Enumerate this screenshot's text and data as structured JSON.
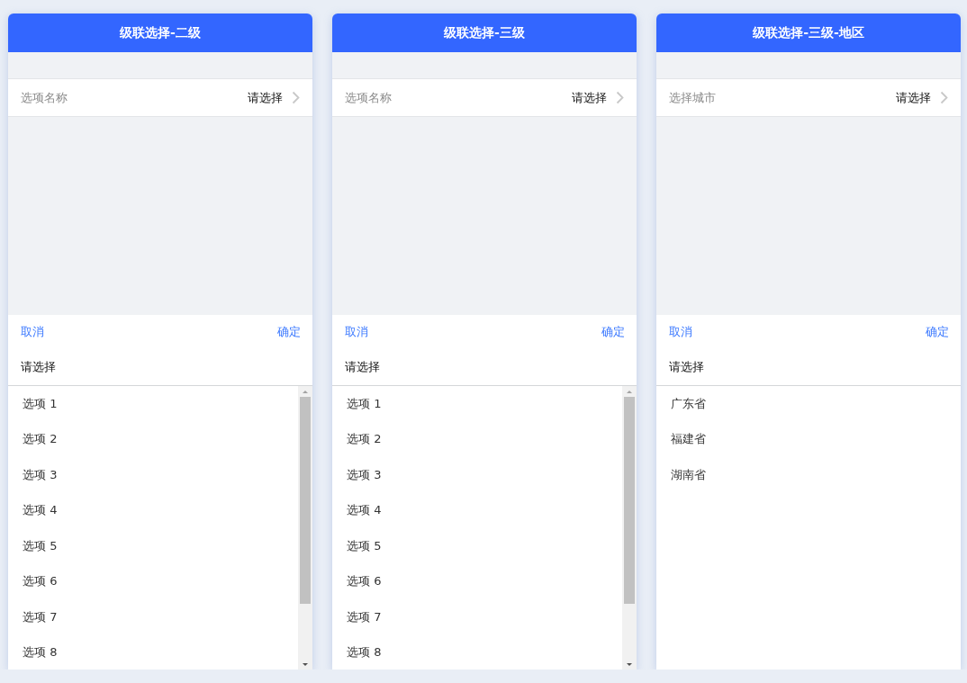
{
  "panels": [
    {
      "title": "级联选择-二级",
      "field": {
        "label": "选项名称",
        "value": "请选择"
      },
      "picker": {
        "cancel": "取消",
        "confirm": "确定",
        "title": "请选择",
        "options": [
          "选项 1",
          "选项 2",
          "选项 3",
          "选项 4",
          "选项 5",
          "选项 6",
          "选项 7",
          "选项 8"
        ]
      }
    },
    {
      "title": "级联选择-三级",
      "field": {
        "label": "选项名称",
        "value": "请选择"
      },
      "picker": {
        "cancel": "取消",
        "confirm": "确定",
        "title": "请选择",
        "options": [
          "选项 1",
          "选项 2",
          "选项 3",
          "选项 4",
          "选项 5",
          "选项 6",
          "选项 7",
          "选项 8"
        ]
      }
    },
    {
      "title": "级联选择-三级-地区",
      "field": {
        "label": "选择城市",
        "value": "请选择"
      },
      "picker": {
        "cancel": "取消",
        "confirm": "确定",
        "title": "请选择",
        "options": [
          "广东省",
          "福建省",
          "湖南省"
        ]
      }
    }
  ]
}
